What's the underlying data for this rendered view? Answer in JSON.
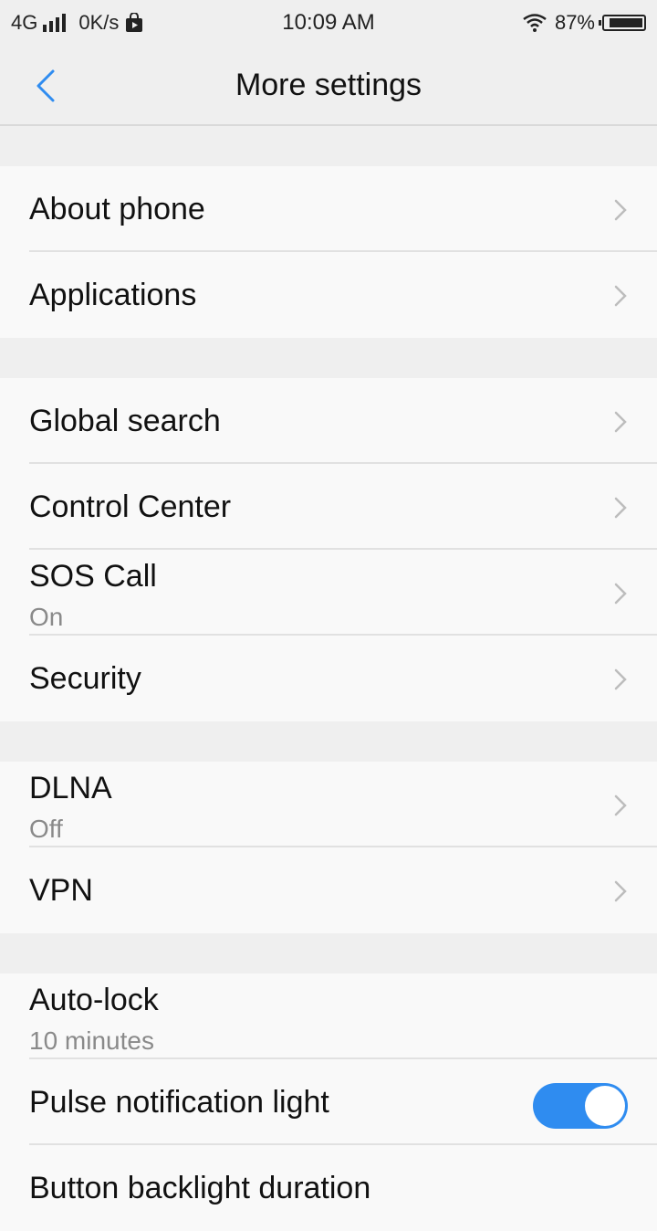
{
  "status": {
    "network": "4G",
    "speed": "0K/s",
    "time": "10:09 AM",
    "battery": "87%"
  },
  "header": {
    "title": "More settings"
  },
  "groups": [
    {
      "items": [
        {
          "label": "About phone"
        },
        {
          "label": "Applications"
        }
      ]
    },
    {
      "items": [
        {
          "label": "Global search"
        },
        {
          "label": "Control Center"
        },
        {
          "label": "SOS Call",
          "sub": "On"
        },
        {
          "label": "Security"
        }
      ]
    },
    {
      "items": [
        {
          "label": "DLNA",
          "sub": "Off"
        },
        {
          "label": "VPN"
        }
      ]
    },
    {
      "items": [
        {
          "label": "Auto-lock",
          "sub": "10 minutes"
        },
        {
          "label": "Pulse notification light",
          "toggle": true
        },
        {
          "label": "Button backlight duration"
        }
      ]
    }
  ],
  "colors": {
    "accent": "#2f8cf0"
  }
}
